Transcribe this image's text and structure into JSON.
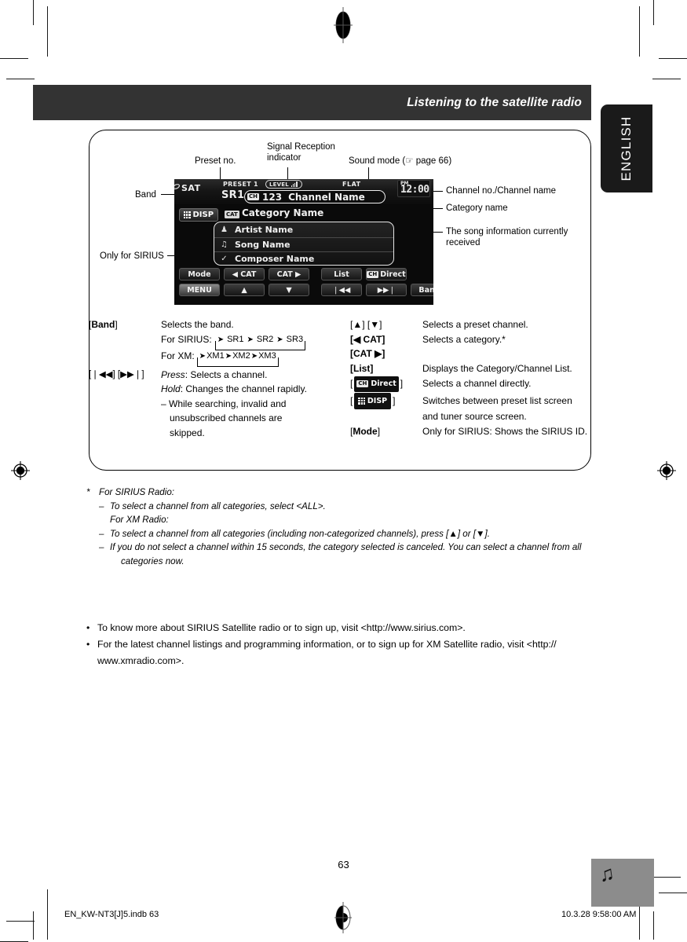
{
  "header": {
    "title": "Listening to the satellite radio"
  },
  "side_tab": {
    "label": "ENGLISH"
  },
  "callouts": {
    "preset_no": "Preset no.",
    "signal_line1": "Signal Reception",
    "signal_line2": "indicator",
    "sound_mode": "Sound mode (☞ page 66)",
    "band": "Band",
    "only_for_sirius": "Only for SIRIUS",
    "channel_no_name": "Channel no./Channel name",
    "category_name": "Category name",
    "song_info_line1": "The song information currently",
    "song_info_line2": "received"
  },
  "lcd": {
    "source": "SAT",
    "preset": "PRESET 1",
    "band": "SR1",
    "level_label": "LEVEL",
    "sound_mode": "FLAT",
    "clock_pm": "PM",
    "clock": "12:00",
    "ch_badge": "CH",
    "channel_number": "123",
    "channel_name": "Channel Name",
    "disp_label": "DISP",
    "cat_badge": "CAT",
    "category_name": "Category Name",
    "info_rows": [
      {
        "icon": "person-icon",
        "glyph": "♟",
        "text": "Artist Name"
      },
      {
        "icon": "music-note-icon",
        "glyph": "♫",
        "text": "Song Name"
      },
      {
        "icon": "check-icon",
        "glyph": "✓",
        "text": "Composer Name"
      }
    ],
    "buttons_row1": [
      {
        "label": "Mode",
        "width": 52
      },
      {
        "label": "◀ CAT",
        "width": 52
      },
      {
        "label": "CAT ▶",
        "width": 52
      },
      {
        "label": "List",
        "width": 52
      },
      {
        "label": "Direct",
        "width": 52,
        "badge": "CH"
      }
    ],
    "buttons_row2": [
      {
        "label": "MENU",
        "width": 52
      },
      {
        "label": "▲",
        "width": 52
      },
      {
        "label": "▼",
        "width": 52
      },
      {
        "label": "❘◀◀",
        "width": 52
      },
      {
        "label": "▶▶❘",
        "width": 52
      },
      {
        "label": "Band",
        "width": 52
      }
    ]
  },
  "key_table": {
    "left": [
      {
        "key_prefix": "[",
        "key_bold": "Band",
        "key_suffix": "]",
        "value": "Selects the band."
      },
      {
        "key_prefix": "",
        "key_bold": "",
        "key_suffix": "",
        "value": "For SIRIUS:",
        "flow": [
          "SR1",
          "SR2",
          "SR3"
        ]
      },
      {
        "key_prefix": "",
        "key_bold": "",
        "key_suffix": "",
        "value": "For XM:",
        "flow": [
          "XM1",
          "XM2",
          "XM3"
        ]
      },
      {
        "key_prefix": "[❘◀◀] [▶▶❘]",
        "key_bold": "",
        "key_suffix": "",
        "value_italic": "Press",
        "value": ": Selects a channel."
      },
      {
        "key_prefix": "",
        "key_bold": "",
        "key_suffix": "",
        "value_italic": "Hold",
        "value": ": Changes the channel rapidly."
      },
      {
        "key_prefix": "",
        "key_bold": "",
        "key_suffix": "",
        "value": "– While searching, invalid and"
      },
      {
        "key_prefix": "",
        "key_bold": "",
        "key_suffix": "",
        "value": "unsubscribed channels are"
      },
      {
        "key_prefix": "",
        "key_bold": "",
        "key_suffix": "",
        "value": "skipped."
      }
    ],
    "right": [
      {
        "key": "[▲] [▼]",
        "value": "Selects a preset channel."
      },
      {
        "key": "[◀ CAT]",
        "value": "Selects a category.*",
        "key_bold": true
      },
      {
        "key": "[CAT ▶]",
        "value": "",
        "key_bold": true
      },
      {
        "key": "[List]",
        "value": "Displays the Category/Channel List.",
        "key_bold": true
      },
      {
        "key": "[ Direct ]",
        "value": "Selects a channel directly.",
        "chip": "direct"
      },
      {
        "key": "[ DISP ]",
        "value": "Switches between preset list screen",
        "chip": "disp"
      },
      {
        "key": "",
        "value": "and tuner source screen."
      },
      {
        "key": "[Mode]",
        "value": "Only for SIRIUS: Shows the SIRIUS ID.",
        "key_bold": true
      }
    ]
  },
  "footnotes": [
    {
      "mark": "*",
      "indent": 0,
      "text": "For SIRIUS Radio:"
    },
    {
      "mark": "–",
      "indent": 1,
      "text": "To select a channel from all categories, select <ALL>."
    },
    {
      "mark": "",
      "indent": 1,
      "text": "For XM Radio:"
    },
    {
      "mark": "–",
      "indent": 1,
      "text": "To select a channel from all categories (including non-categorized channels), press [▲] or [▼]."
    },
    {
      "mark": "–",
      "indent": 1,
      "text": "If you do not select a channel within 15 seconds, the category selected is canceled. You can select a channel from all"
    },
    {
      "mark": "",
      "indent": 2,
      "text": "categories now."
    }
  ],
  "bullets": [
    {
      "dot": "•",
      "text": "To know more about SIRIUS Satellite radio or to sign up, visit <http://www.sirius.com>."
    },
    {
      "dot": "•",
      "text": "For the latest channel listings and programming information, or to sign up for XM Satellite radio, visit <http://"
    },
    {
      "dot": "",
      "text": "www.xmradio.com>."
    }
  ],
  "footer": {
    "page_number": "63",
    "file_name": "EN_KW-NT3[J]5.indb   63",
    "date_time": "10.3.28   9:58:00 AM",
    "music_icon": "music-notes-icon"
  },
  "colors": {
    "header_bg": "#333333",
    "tab_bg": "#1a1a1a",
    "lcd_bg": "#0a0a0a",
    "music_box_bg": "#8c8c8c"
  }
}
